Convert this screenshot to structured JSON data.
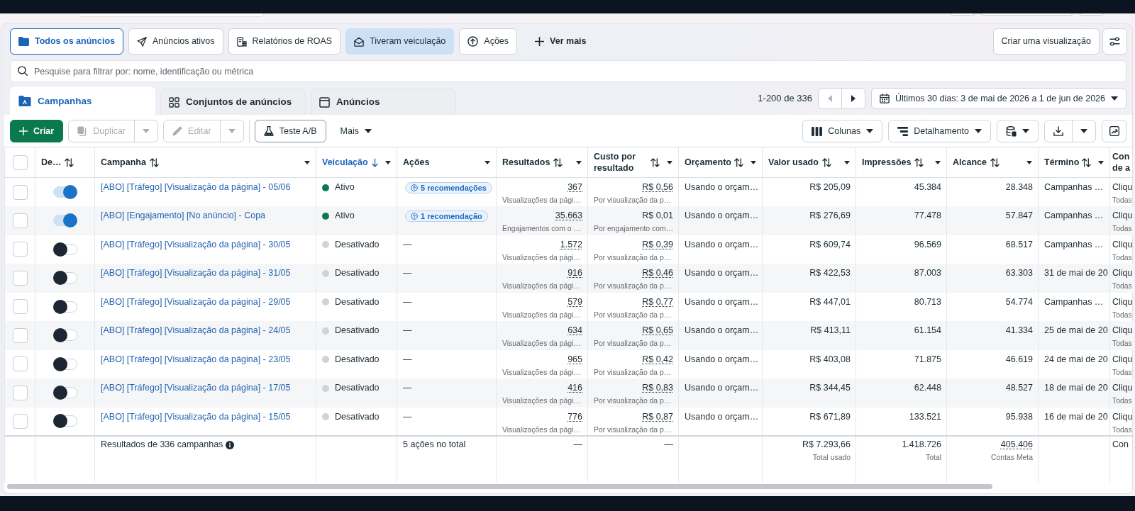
{
  "filter_tabs": [
    {
      "label": "Todos os anúncios",
      "selected": true,
      "highlighted": false
    },
    {
      "label": "Anúncios ativos",
      "selected": false,
      "highlighted": false
    },
    {
      "label": "Relatórios de ROAS",
      "selected": false,
      "highlighted": false
    },
    {
      "label": "Tiveram veiculação",
      "selected": false,
      "highlighted": true
    },
    {
      "label": "Ações",
      "selected": false,
      "highlighted": false
    }
  ],
  "more_filters": {
    "label": "Ver mais"
  },
  "create_view": {
    "label": "Criar uma visualização"
  },
  "search": {
    "placeholder": "Pesquise para filtrar por: nome, identificação ou métrica"
  },
  "level_tabs": [
    {
      "label": "Campanhas",
      "selected": true
    },
    {
      "label": "Conjuntos de anúncios",
      "selected": false
    },
    {
      "label": "Anúncios",
      "selected": false
    }
  ],
  "pagination": {
    "range": "1-200 de 336",
    "previous": {
      "disabled": true
    },
    "next": {
      "disabled": false
    }
  },
  "date_range": {
    "label": "Últimos 30 dias: 3 de mai de 2026 a 1 de jun de 2026"
  },
  "toolbar": [
    {
      "kind": "primary",
      "label": "Criar",
      "disabled": false
    },
    {
      "kind": "split",
      "label": "Duplicar",
      "disabled": true
    },
    {
      "kind": "split",
      "label": "Editar",
      "disabled": true
    },
    {
      "kind": "outline",
      "label": "Teste A/B",
      "disabled": false
    },
    {
      "kind": "menu",
      "label": "Mais",
      "disabled": false
    }
  ],
  "view_toolbar": [
    {
      "label": "Colunas"
    },
    {
      "label": "Detalhamento"
    }
  ],
  "table": {
    "header_checkbox": {
      "checked": false
    },
    "columns": [
      {
        "label": "De…",
        "sortable": true,
        "sorted": false,
        "menu": false
      },
      {
        "label": "Campanha",
        "sortable": true,
        "sorted": false,
        "menu": true
      },
      {
        "label": "Veiculação",
        "sortable": true,
        "sorted": true,
        "menu": true
      },
      {
        "label": "Ações",
        "sortable": false,
        "sorted": false,
        "menu": true
      },
      {
        "label": "Resultados",
        "sortable": true,
        "sorted": false,
        "menu": true
      },
      {
        "label": "Custo por resultado",
        "sortable": true,
        "sorted": false,
        "menu": true
      },
      {
        "label": "Orçamento",
        "sortable": true,
        "sorted": false,
        "menu": true
      },
      {
        "label": "Valor usado",
        "sortable": true,
        "sorted": false,
        "menu": true
      },
      {
        "label": "Impressões",
        "sortable": true,
        "sorted": false,
        "menu": true
      },
      {
        "label": "Alcance",
        "sortable": true,
        "sorted": false,
        "menu": true
      },
      {
        "label": "Término",
        "sortable": true,
        "sorted": false,
        "menu": true
      },
      {
        "label": "Con de a",
        "sortable": false,
        "sorted": false,
        "menu": false
      }
    ],
    "rows": [
      {
        "checked": false,
        "on": true,
        "name": "[ABO] [Tráfego] [Visualização da página] - 05/06",
        "status": "Ativo",
        "color": "#0a7b4f",
        "actions": {
          "kind": "chip",
          "label": "5 recomendações"
        },
        "results": "367",
        "results_label": "Visualizações da pági…",
        "cost": "R$ 0,56",
        "cost_underlined": true,
        "cost_label": "Por visualização da p…",
        "budget": "Usando o orçam…",
        "spent": "R$ 205,09",
        "impressions": "45.384",
        "reach": "28.348",
        "end": "Campanhas …",
        "column_13": "Cliqu",
        "column_13_sub": "Todas"
      },
      {
        "checked": false,
        "on": true,
        "name": "[ABO] [Engajamento] [No anúncio] - Copa",
        "status": "Ativo",
        "color": "#0a7b4f",
        "actions": {
          "kind": "chip",
          "label": "1 recomendação"
        },
        "results": "35.663",
        "results_label": "Engajamentos com o …",
        "cost": "R$ 0,01",
        "cost_underlined": false,
        "cost_label": "Por engajamento com…",
        "budget": "Usando o orçam…",
        "spent": "R$ 276,69",
        "impressions": "77.478",
        "reach": "57.847",
        "end": "Campanhas …",
        "column_13": "Cliqu",
        "column_13_sub": "Todas"
      },
      {
        "checked": false,
        "on": false,
        "name": "[ABO] [Tráfego] [Visualização da página] - 30/05",
        "status": "Desativado",
        "color": "#cfd3d8",
        "actions": {
          "kind": "text",
          "label": "—"
        },
        "results": "1.572",
        "results_label": "Visualizações da pági…",
        "cost": "R$ 0,39",
        "cost_underlined": true,
        "cost_label": "Por visualização da p…",
        "budget": "Usando o orçam…",
        "spent": "R$ 609,74",
        "impressions": "96.569",
        "reach": "68.517",
        "end": "Campanhas …",
        "column_13": "Cliqu",
        "column_13_sub": "Todas"
      },
      {
        "checked": false,
        "on": false,
        "name": "[ABO] [Tráfego] [Visualização da página] - 31/05",
        "status": "Desativado",
        "color": "#cfd3d8",
        "actions": {
          "kind": "text",
          "label": "—"
        },
        "results": "916",
        "results_label": "Visualizações da pági…",
        "cost": "R$ 0,46",
        "cost_underlined": true,
        "cost_label": "Por visualização da p…",
        "budget": "Usando o orçam…",
        "spent": "R$ 422,53",
        "impressions": "87.003",
        "reach": "63.303",
        "end": "31 de mai de 20",
        "column_13": "Cliqu",
        "column_13_sub": "Todas"
      },
      {
        "checked": false,
        "on": false,
        "name": "[ABO] [Tráfego] [Visualização da página] - 29/05",
        "status": "Desativado",
        "color": "#cfd3d8",
        "actions": {
          "kind": "text",
          "label": "—"
        },
        "results": "579",
        "results_label": "Visualizações da pági…",
        "cost": "R$ 0,77",
        "cost_underlined": true,
        "cost_label": "Por visualização da p…",
        "budget": "Usando o orçam…",
        "spent": "R$ 447,01",
        "impressions": "80.713",
        "reach": "54.774",
        "end": "Campanhas …",
        "column_13": "Cliqu",
        "column_13_sub": "Todas"
      },
      {
        "checked": false,
        "on": false,
        "name": "[ABO] [Tráfego] [Visualização da página] - 24/05",
        "status": "Desativado",
        "color": "#cfd3d8",
        "actions": {
          "kind": "text",
          "label": "—"
        },
        "results": "634",
        "results_label": "Visualizações da pági…",
        "cost": "R$ 0,65",
        "cost_underlined": true,
        "cost_label": "Por visualização da p…",
        "budget": "Usando o orçam…",
        "spent": "R$ 413,11",
        "impressions": "61.154",
        "reach": "41.334",
        "end": "25 de mai de 20",
        "column_13": "Cliqu",
        "column_13_sub": "Todas"
      },
      {
        "checked": false,
        "on": false,
        "name": "[ABO] [Tráfego] [Visualização da página] - 23/05",
        "status": "Desativado",
        "color": "#cfd3d8",
        "actions": {
          "kind": "text",
          "label": "—"
        },
        "results": "965",
        "results_label": "Visualizações da pági…",
        "cost": "R$ 0,42",
        "cost_underlined": true,
        "cost_label": "Por visualização da p…",
        "budget": "Usando o orçam…",
        "spent": "R$ 403,08",
        "impressions": "71.875",
        "reach": "46.619",
        "end": "24 de mai de 20",
        "column_13": "Cliqu",
        "column_13_sub": "Todas"
      },
      {
        "checked": false,
        "on": false,
        "name": "[ABO] [Tráfego] [Visualização da página] - 17/05",
        "status": "Desativado",
        "color": "#cfd3d8",
        "actions": {
          "kind": "text",
          "label": "—"
        },
        "results": "416",
        "results_label": "Visualizações da pági…",
        "cost": "R$ 0,83",
        "cost_underlined": true,
        "cost_label": "Por visualização da p…",
        "budget": "Usando o orçam…",
        "spent": "R$ 344,45",
        "impressions": "62.448",
        "reach": "48.527",
        "end": "18 de mai de 20",
        "column_13": "Cliqu",
        "column_13_sub": "Todas"
      },
      {
        "checked": false,
        "on": false,
        "name": "[ABO] [Tráfego] [Visualização da página] - 15/05",
        "status": "Desativado",
        "color": "#cfd3d8",
        "actions": {
          "kind": "text",
          "label": "—"
        },
        "results": "776",
        "results_label": "Visualizações da pági…",
        "cost": "R$ 0,87",
        "cost_underlined": true,
        "cost_label": "Por visualização da p…",
        "budget": "Usando o orçam…",
        "spent": "R$ 671,89",
        "impressions": "133.521",
        "reach": "95.938",
        "end": "16 de mai de 20",
        "column_13": "Cliqu",
        "column_13_sub": "Todas"
      }
    ],
    "summary": {
      "label": "Resultados de 336 campanhas",
      "actions": "5 ações no total",
      "results": "—",
      "cost": "—",
      "spent": "R$ 7.293,66",
      "spent_label": "Total usado",
      "impressions": "1.418.726",
      "impressions_label": "Total",
      "reach": "405.406",
      "reach_label": "Contas Meta",
      "column_13": "Con"
    }
  }
}
